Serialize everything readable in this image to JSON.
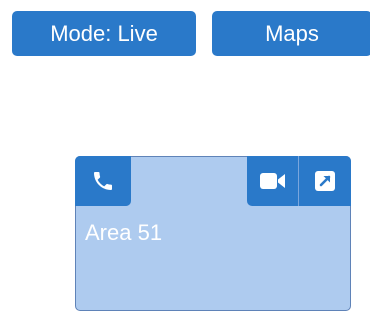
{
  "toolbar": {
    "mode_label": "Mode: Live",
    "maps_label": "Maps"
  },
  "camera_tile": {
    "title": "Area 51",
    "icons": [
      "phone-icon",
      "video-camera-icon",
      "expand-icon"
    ]
  },
  "colors": {
    "accent": "#2a79c9",
    "tile_background": "#aecbef",
    "tile_border": "#5f83b8",
    "text_on_accent": "#ffffff"
  }
}
